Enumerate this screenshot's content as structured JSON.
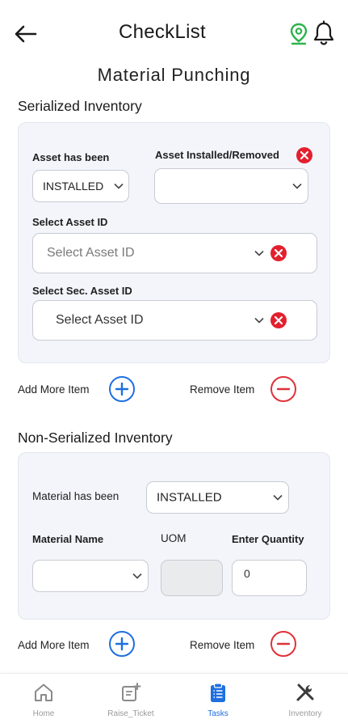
{
  "header": {
    "title": "CheckList",
    "icons": [
      "back-arrow-icon",
      "location-pin-icon",
      "bell-icon"
    ],
    "location_color": "#2bb34a"
  },
  "subtitle": "Material Punching",
  "serialized": {
    "section_title": "Serialized Inventory",
    "asset_status_label": "Asset has been",
    "asset_status_value": "INSTALLED",
    "installed_removed_label": "Asset Installed/Removed",
    "installed_removed_value": "",
    "asset_id_label": "Select Asset ID",
    "asset_id_placeholder": "Select Asset ID",
    "sec_asset_id_label": "Select Sec. Asset ID",
    "sec_asset_id_placeholder": "Select Asset ID"
  },
  "serialized_actions": {
    "add_label": "Add More Item",
    "remove_label": "Remove Item"
  },
  "non_serialized": {
    "section_title": "Non-Serialized Inventory",
    "material_status_label": "Material has been",
    "material_status_value": "INSTALLED",
    "material_name_label": "Material Name",
    "material_name_value": "",
    "uom_label": "UOM",
    "uom_value": "",
    "quantity_label": "Enter Quantity",
    "quantity_value": "0"
  },
  "non_serialized_actions": {
    "add_label": "Add More Item",
    "remove_label": "Remove Item"
  },
  "colors": {
    "accent_blue": "#1e6fe0",
    "danger_red": "#e3202e",
    "card_bg": "#f3f5fb"
  },
  "bottom_nav": {
    "items": [
      {
        "label": "Home",
        "icon": "home-icon",
        "active": false
      },
      {
        "label": "Raise_Ticket",
        "icon": "raise-ticket-icon",
        "active": false
      },
      {
        "label": "Tasks",
        "icon": "tasks-clipboard-icon",
        "active": true
      },
      {
        "label": "Inventory",
        "icon": "tools-icon",
        "active": false
      }
    ]
  }
}
